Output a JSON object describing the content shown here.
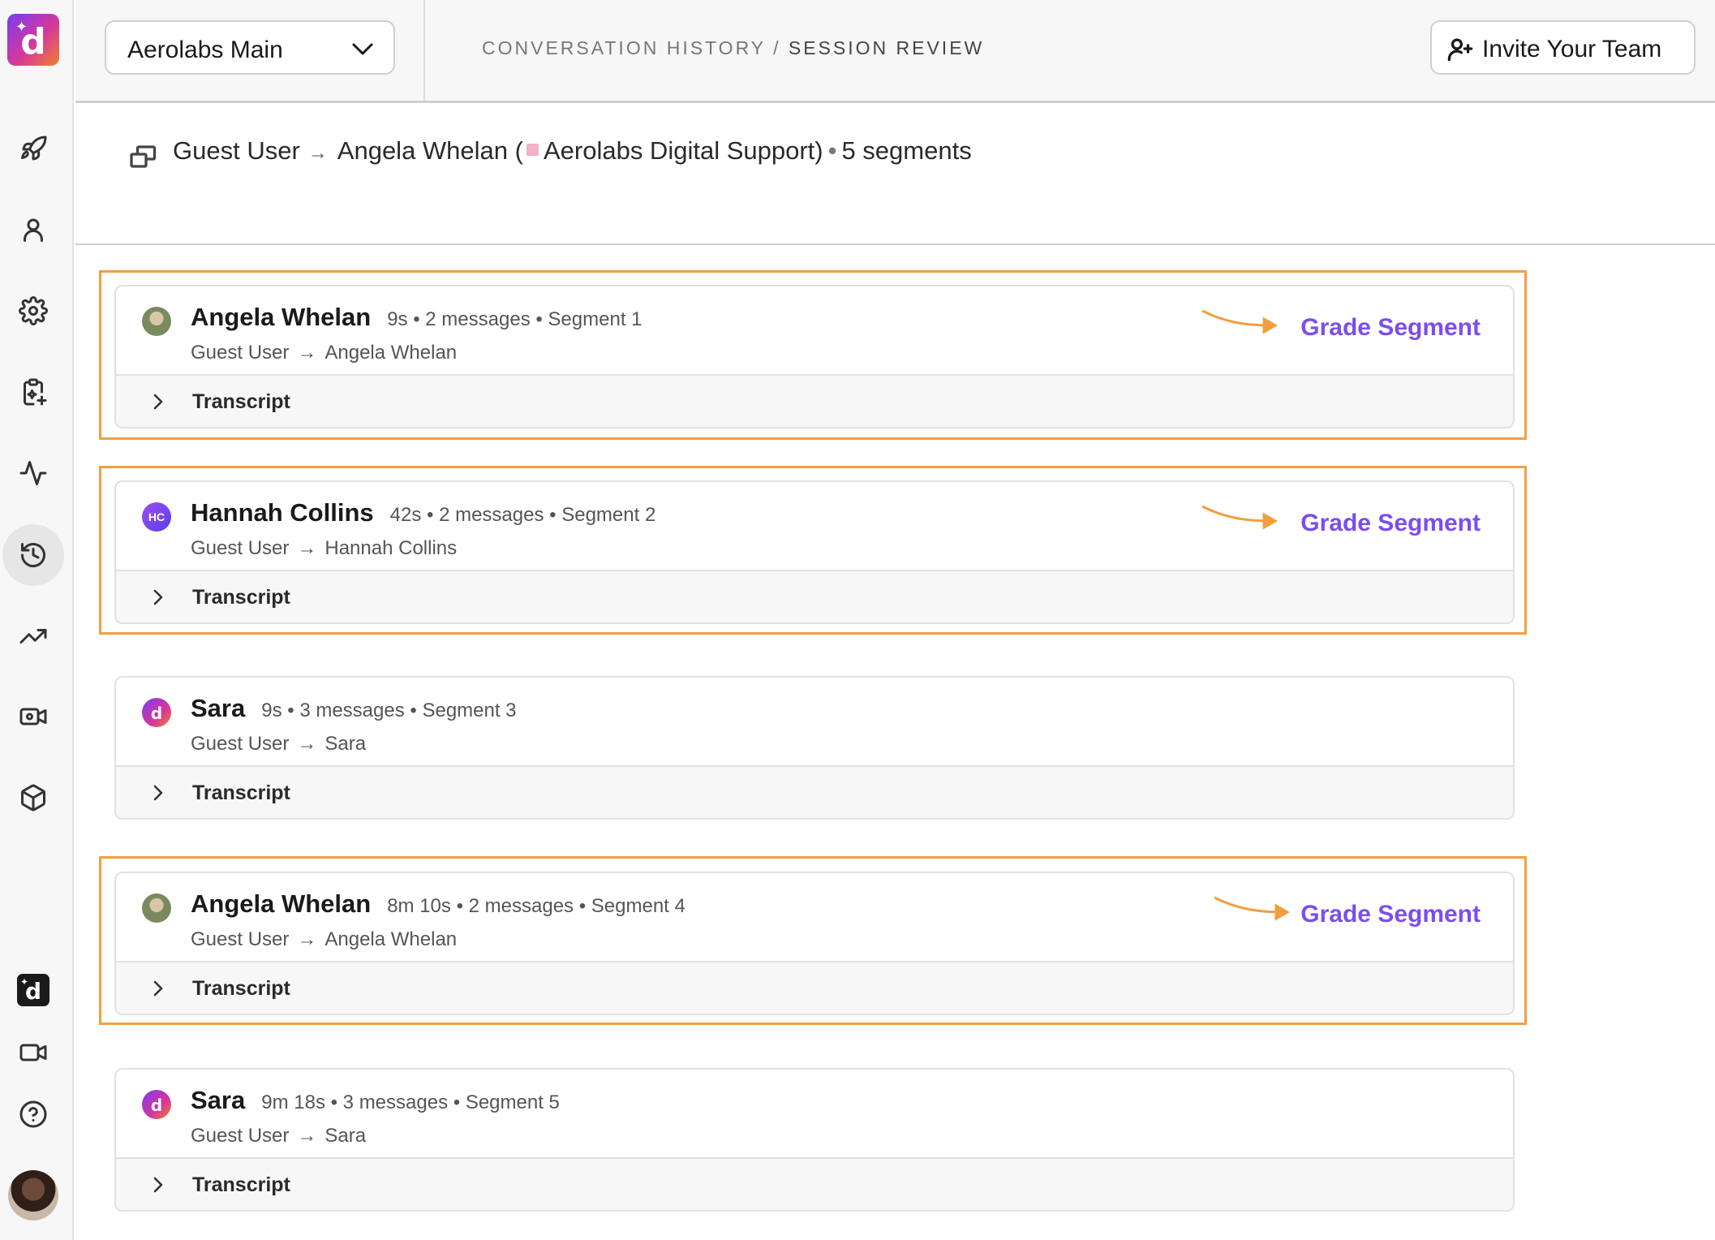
{
  "app": {
    "brand_colors": [
      "#7a3cf0",
      "#d6379a",
      "#f0822a"
    ],
    "accent": "#7b4df0",
    "highlight": "#f0a040"
  },
  "sidebar": {
    "icons": [
      "rocket-icon",
      "user-icon",
      "gear-icon",
      "clipboard-sparkle-icon",
      "activity-icon",
      "history-icon",
      "trending-up-icon",
      "video-settings-icon",
      "cube-icon",
      "brand-icon",
      "video-icon",
      "help-icon"
    ],
    "active": "history-icon"
  },
  "header": {
    "workspace": "Aerolabs Main",
    "breadcrumb_parent": "CONVERSATION HISTORY",
    "breadcrumb_separator": " / ",
    "breadcrumb_current": "SESSION REVIEW",
    "invite_label": "Invite Your Team"
  },
  "summary": {
    "from": "Guest User",
    "to": "Angela Whelan (",
    "team": "Aerolabs Digital Support)",
    "segment_count": "5 segments"
  },
  "segments": [
    {
      "name": "Angela Whelan",
      "meta": "9s • 2 messages • Segment 1",
      "from": "Guest User",
      "to": "Angela Whelan",
      "transcript": "Transcript",
      "grade": "Grade Segment"
    },
    {
      "name": "Hannah Collins",
      "initials": "HC",
      "meta": "42s • 2 messages • Segment 2",
      "from": "Guest User",
      "to": "Hannah Collins",
      "transcript": "Transcript",
      "grade": "Grade Segment"
    },
    {
      "name": "Sara",
      "initials": "d",
      "meta": "9s • 3 messages • Segment 3",
      "from": "Guest User",
      "to": "Sara",
      "transcript": "Transcript"
    },
    {
      "name": "Angela Whelan",
      "meta": "8m 10s • 2 messages • Segment 4",
      "from": "Guest User",
      "to": "Angela Whelan",
      "transcript": "Transcript",
      "grade": "Grade Segment"
    },
    {
      "name": "Sara",
      "initials": "d",
      "meta": "9m 18s • 3 messages • Segment 5",
      "from": "Guest User",
      "to": "Sara",
      "transcript": "Transcript"
    }
  ],
  "arrow_glyph": "→"
}
